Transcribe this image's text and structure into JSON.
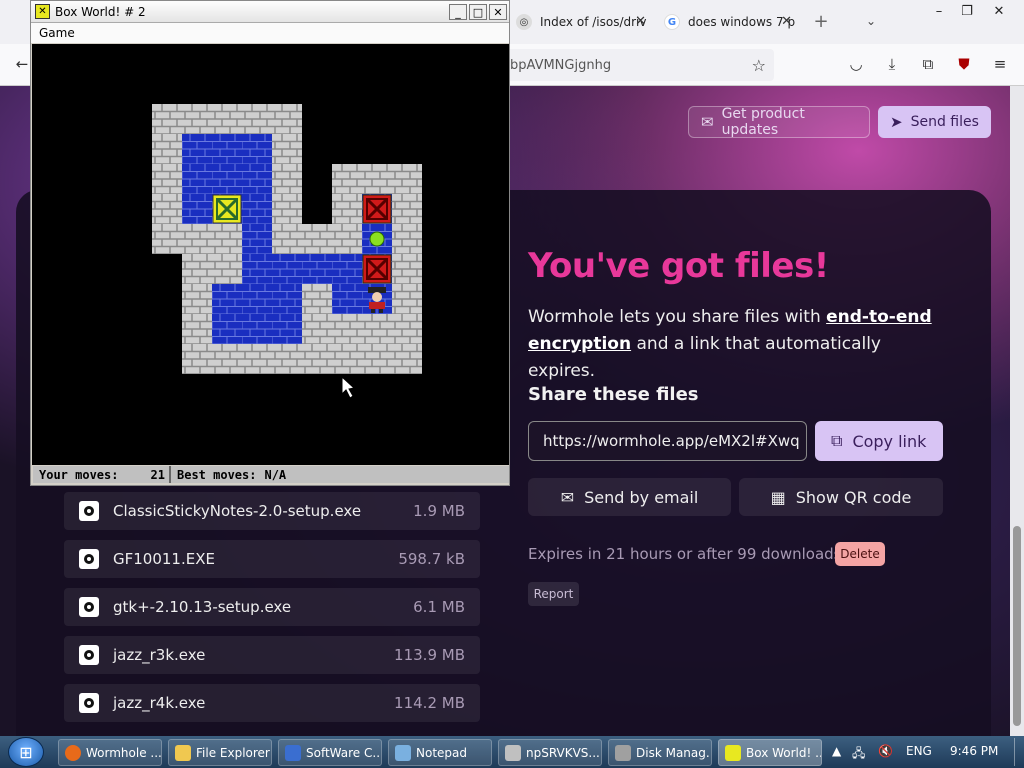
{
  "browser": {
    "tabs": [
      {
        "label": "Index of /isos/driv",
        "icon": "site-icon"
      },
      {
        "label": "does windows 7 p",
        "icon": "google-icon"
      }
    ],
    "url_fragment": "bpAVMNGjgnhg",
    "window_controls": [
      "minimize",
      "maximize",
      "close"
    ]
  },
  "page": {
    "top_buttons": {
      "updates": "Get product updates",
      "send": "Send files"
    },
    "headline": "You've got files!",
    "description": {
      "part1": "Wormhole lets you share files with ",
      "link": "end-to-end encryption",
      "part2": " and a link that automatically expires."
    },
    "share_heading": "Share these files",
    "share_link": "https://wormhole.app/eMX2l#Xwq",
    "copy_label": "Copy link",
    "email_label": "Send by email",
    "qr_label": "Show QR code",
    "expires_text": "Expires in 21 hours or after 99 downloads",
    "delete_label": "Delete",
    "report_label": "Report",
    "files": [
      {
        "name": "ClassicStickyNotes-2.0-setup.exe",
        "size": "1.9 MB"
      },
      {
        "name": "GF10011.EXE",
        "size": "598.7 kB"
      },
      {
        "name": "gtk+-2.10.13-setup.exe",
        "size": "6.1 MB"
      },
      {
        "name": "jazz_r3k.exe",
        "size": "113.9 MB"
      },
      {
        "name": "jazz_r4k.exe",
        "size": "114.2 MB"
      }
    ]
  },
  "game": {
    "title": "Box World! # 2",
    "menu": "Game",
    "status": {
      "moves_label": "Your moves:",
      "moves": "21",
      "best_label": "Best moves:",
      "best": "N/A"
    }
  },
  "taskbar": {
    "items": [
      {
        "label": "Wormhole ...",
        "color": "#e86a1a"
      },
      {
        "label": "File Explorer",
        "color": "#f0c850"
      },
      {
        "label": "SoftWare C...",
        "color": "#3a6ed0"
      },
      {
        "label": "Notepad",
        "color": "#7ab0e0"
      },
      {
        "label": "npSRVKVS...",
        "color": "#c0c0c0"
      },
      {
        "label": "Disk Manag...",
        "color": "#a0a0a0"
      },
      {
        "label": "Box World! ...",
        "color": "#e8e820"
      }
    ],
    "lang": "ENG",
    "time": "9:46 PM"
  }
}
